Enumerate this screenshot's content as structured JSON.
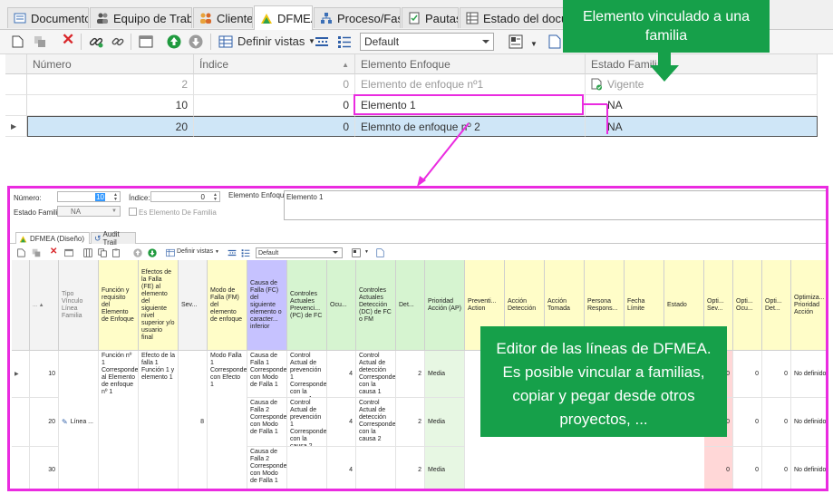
{
  "tabs": [
    {
      "label": "Documentos",
      "icon": "document-icon"
    },
    {
      "label": "Equipo de Trabajo",
      "icon": "team-icon"
    },
    {
      "label": "Clientes",
      "icon": "clients-icon"
    },
    {
      "label": "DFMEA",
      "icon": "dfmea-icon",
      "active": true
    },
    {
      "label": "Proceso/Fases",
      "icon": "process-icon"
    },
    {
      "label": "Pautas",
      "icon": "guidelines-icon"
    },
    {
      "label": "Estado del docume",
      "icon": "status-grid-icon"
    }
  ],
  "toolbar": {
    "views_label": "Definir vistas",
    "view_value": "Default"
  },
  "grid": {
    "columns": [
      "Número",
      "Índice",
      "Elemento Enfoque",
      "Estado Familia"
    ],
    "rows": [
      {
        "numero": "2",
        "indice": "0",
        "elemento": "Elemento de enfoque nº1",
        "estado": "Vigente"
      },
      {
        "numero": "10",
        "indice": "0",
        "elemento": "Elemento 1",
        "estado": "NA"
      },
      {
        "numero": "20",
        "indice": "0",
        "elemento": "Elemnto de enfoque nº 2",
        "estado": "NA"
      }
    ]
  },
  "callouts": {
    "family": "Elemento vinculado a una familia",
    "editor": "Editor de las líneas de DFMEA. Es posible vincular a familias, copiar y pegar desde otros proyectos, ..."
  },
  "colors": {
    "callout_green": "#16a04a",
    "highlight_magenta": "#ea2be0",
    "selected_row": "#cfe6f7"
  },
  "editor": {
    "numero_label": "Número:",
    "numero_value": "10",
    "indice_label": "Índice:",
    "indice_value": "0",
    "estado_familia_label": "Estado Familia:",
    "estado_familia_value": "NA",
    "es_elemento_label": "Es Elemento De Familia",
    "elemento_enfoque_label": "Elemento Enfoque:",
    "elemento_enfoque_value": "Elemento 1",
    "subtabs": [
      "DFMEA (Diseño)",
      "Audit Trail"
    ],
    "views_label": "Definir vistas",
    "view_value": "Default",
    "headers": {
      "tipo": "Tipo Vínculo Línea Familia",
      "funcion": "Función y requisito del Elemento de Enfoque",
      "efectos": "Efectos de la Falla (FE) al elemento del siguiente nivel superior y/o usuario final",
      "sev": "Sev...",
      "modo": "Modo de Falla (FM) del elemento de enfoque",
      "causa": "Causa de Falla (FC) del siguiente elemento o caracter... inferior",
      "ctrl_prev": "Controles Actuales Prevenci... (PC) de FC",
      "ocu": "Ocu...",
      "ctrl_det": "Controles Actuales Detección (DC) de FC o FM",
      "det": "Det...",
      "prioridad": "Prioridad Acción (AP)",
      "prev_action": "Preventi... Action",
      "accion_det": "Acción Detección",
      "accion_tomada": "Acción Tomada",
      "persona": "Persona Respons...",
      "fecha": "Fecha Límite",
      "estado": "Estado",
      "opt_sev": "Opti... Sev...",
      "opt_ocu": "Opti... Ocu...",
      "opt_det": "Opti... Det...",
      "opt_prioridad": "Optimiza... Prioridad Acción"
    },
    "rows": [
      {
        "num": "10",
        "ocu": "4",
        "det": "2",
        "ap": "Media",
        "opt_sev": "0",
        "opt_ocu": "0",
        "opt_det": "0",
        "opt_ap": "No definido",
        "causa": "Causa de Falla 1 Corresponde con Modo de Falla 1",
        "ctrl_prev": "Control Actual de prevención 1 Corresponde con la causa 1",
        "ctrl_det": "Control Actual de detección Corresponde con la causa 1"
      },
      {
        "num": "20",
        "ocu": "4",
        "det": "2",
        "ap": "Media",
        "opt_sev": "0",
        "opt_ocu": "0",
        "opt_det": "0",
        "opt_ap": "No definido",
        "causa": "Causa de Falla 2 Corresponde con Modo de Falla 1",
        "ctrl_prev": "Control Actual de prevención 1 Corresponde con la causa 2",
        "ctrl_det": "Control Actual de detección Corresponde con la causa 2"
      },
      {
        "num": "30",
        "ocu": "4",
        "det": "2",
        "ap": "Media",
        "opt_sev": "0",
        "opt_ocu": "0",
        "opt_det": "0",
        "opt_ap": "No definido",
        "causa": "Causa de Falla 2 Corresponde con Modo de Falla 1",
        "ctrl_prev": "",
        "ctrl_det": ""
      }
    ],
    "group": {
      "tipo": "Línea ...",
      "funcion": "Función nº 1 Corresponde al Elemento de enfoque nº 1",
      "efectos": "Efecto de la falla 1 Función 1 y elemento 1",
      "sev": "8",
      "modo": "Modo Falla 1 Corresponde con Efecto 1"
    }
  }
}
